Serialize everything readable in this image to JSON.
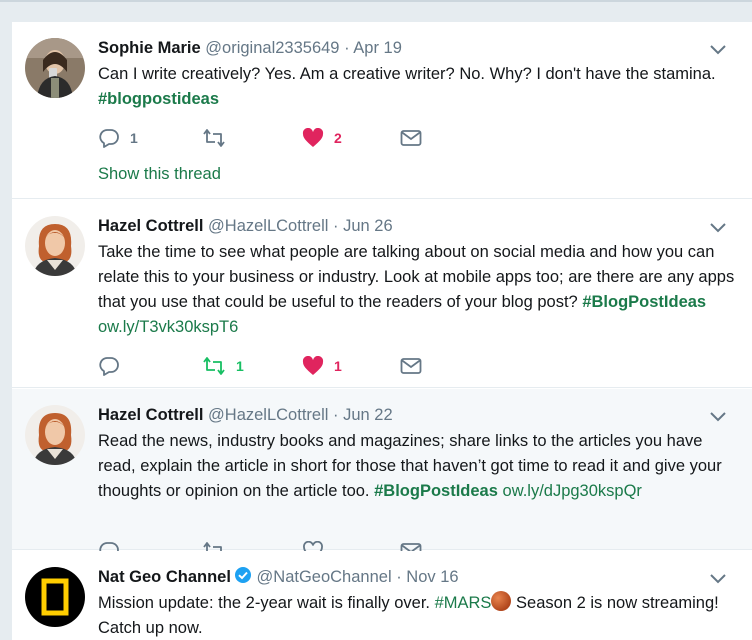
{
  "colors": {
    "accent": "#1b7a4a",
    "like": "#e0245e",
    "muted": "#657786",
    "retweet": "#17bf63"
  },
  "tweets": [
    {
      "name": "Sophie Marie",
      "handle": "@original2335649",
      "dot": "·",
      "date": "Apr 19",
      "text": "Can I write creatively? Yes. Am a creative writer? No. Why? I don't have the stamina.",
      "hashtag": "#blogpostideas",
      "reply_count": "1",
      "retweet_count": "",
      "like_count": "2",
      "liked": true,
      "retweeted": false,
      "show_thread": "Show this thread"
    },
    {
      "name": "Hazel Cottrell",
      "handle": "@HazelLCottrell",
      "dot": "·",
      "date": "Jun 26",
      "text": "Take the time to see what people are talking about on social media and how you can relate this to your business or industry. Look at mobile apps too; are there are any apps that you use that could be useful to the readers of your blog post?",
      "hashtag": "#BlogPostIdeas",
      "link": "ow.ly/T3vk30kspT6",
      "reply_count": "",
      "retweet_count": "1",
      "like_count": "1",
      "liked": true,
      "retweeted": true
    },
    {
      "name": "Hazel Cottrell",
      "handle": "@HazelLCottrell",
      "dot": "·",
      "date": "Jun 22",
      "text": "Read the news, industry books and magazines; share links to the articles you have read, explain the article in short for those that haven’t got time to read it and give your thoughts or opinion on the article too.",
      "hashtag": "#BlogPostIdeas",
      "link": "ow.ly/dJpg30kspQr",
      "reply_count": "",
      "retweet_count": "",
      "like_count": "",
      "liked": false,
      "retweeted": false
    },
    {
      "name": "Nat Geo Channel",
      "handle": "@NatGeoChannel",
      "dot": "·",
      "date": "Nov 16",
      "text_before": "Mission update: the 2-year wait is finally over.",
      "hashtag": "#MARS",
      "text_after": "Season 2 is now streaming! Catch up now.",
      "verified": true
    }
  ]
}
